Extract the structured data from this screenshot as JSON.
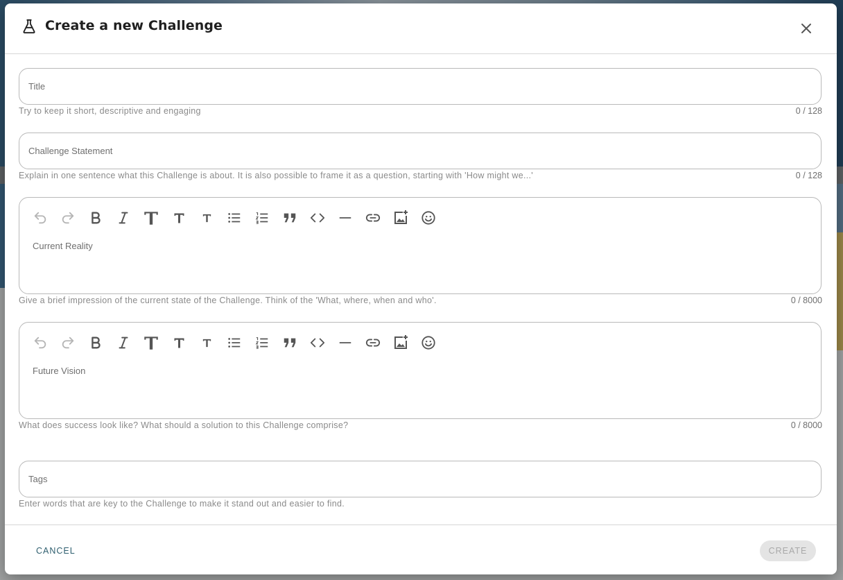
{
  "dialog": {
    "title": "Create a new Challenge",
    "icon": "flask-icon",
    "close_icon": "close-icon"
  },
  "fields": {
    "title": {
      "placeholder": "Title",
      "helper": "Try to keep it short, descriptive and engaging",
      "counter": "0 / 128"
    },
    "statement": {
      "placeholder": "Challenge Statement",
      "helper": "Explain in one sentence what this Challenge is about. It is also possible to frame it as a question, starting with 'How might we...'",
      "counter": "0 / 128"
    },
    "current_reality": {
      "placeholder": "Current Reality",
      "helper": "Give a brief impression of the current state of the Challenge. Think of the 'What, where, when and who'.",
      "counter": "0 / 8000"
    },
    "future_vision": {
      "placeholder": "Future Vision",
      "helper": "What does success look like? What should a solution to this Challenge comprise?",
      "counter": "0 / 8000"
    },
    "tags": {
      "placeholder": "Tags",
      "helper": "Enter words that are key to the Challenge to make it stand out and easier to find."
    }
  },
  "toolbar_icons": [
    "undo-icon",
    "redo-icon",
    "bold-icon",
    "italic-icon",
    "heading-1-icon",
    "heading-2-icon",
    "heading-3-icon",
    "bullet-list-icon",
    "numbered-list-icon",
    "blockquote-icon",
    "code-icon",
    "horizontal-rule-icon",
    "link-icon",
    "add-image-icon",
    "emoji-icon"
  ],
  "footer": {
    "cancel_label": "CANCEL",
    "create_label": "CREATE"
  },
  "colors": {
    "accent": "#2f5f6f",
    "disabled_bg": "#e4e4e4",
    "disabled_text": "#a9a9a9"
  }
}
